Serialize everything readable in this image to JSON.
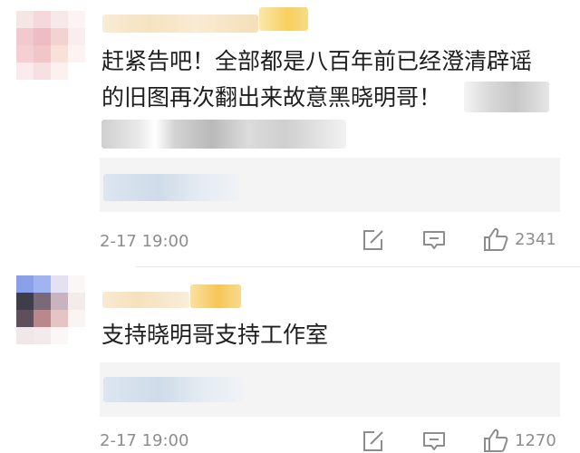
{
  "comments": [
    {
      "text_line1": "赶紧告吧！全部都是八百年前已经澄清辟谣",
      "text_line2": "的旧图再次翻出来故意黑晓明哥！",
      "timestamp": "2-17 19:00",
      "likes": "2341",
      "icons": [
        "edit-icon",
        "comment-icon",
        "thumbs-up-icon"
      ]
    },
    {
      "text": "支持晓明哥支持工作室",
      "timestamp": "2-17 19:00",
      "likes": "1270"
    }
  ],
  "colors": {
    "text": "#1e1e1e",
    "meta": "#8d8d8d",
    "reply_bg": "#f4f4f4"
  }
}
